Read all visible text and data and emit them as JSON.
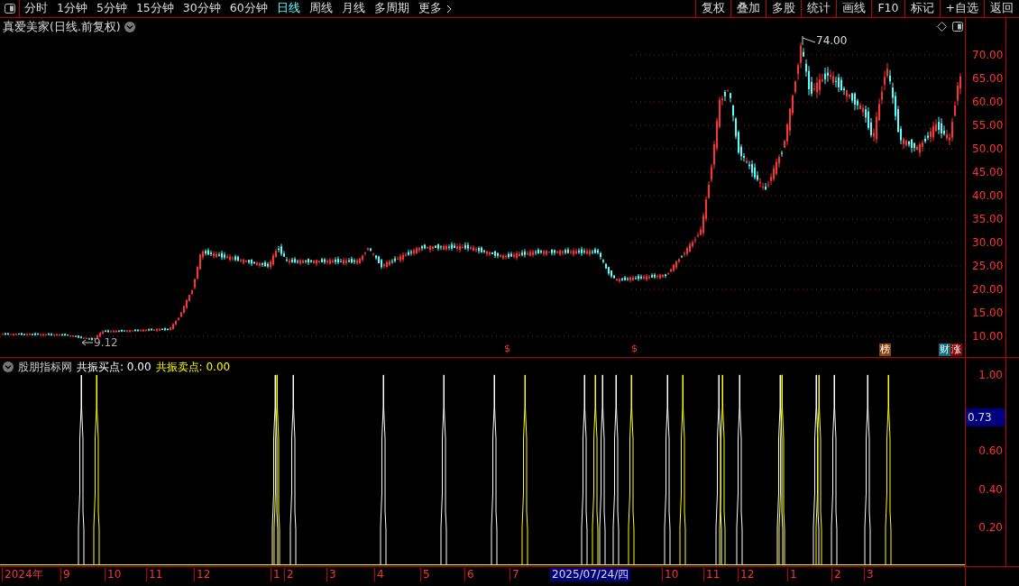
{
  "toolbar": {
    "periods": [
      {
        "label": "分时",
        "selected": false
      },
      {
        "label": "1分钟",
        "selected": false
      },
      {
        "label": "5分钟",
        "selected": false
      },
      {
        "label": "15分钟",
        "selected": false
      },
      {
        "label": "30分钟",
        "selected": false
      },
      {
        "label": "60分钟",
        "selected": false
      },
      {
        "label": "日线",
        "selected": true
      },
      {
        "label": "周线",
        "selected": false
      },
      {
        "label": "月线",
        "selected": false
      },
      {
        "label": "多周期",
        "selected": false
      },
      {
        "label": "更多",
        "selected": false
      }
    ],
    "buttons": [
      "复权",
      "叠加",
      "多股",
      "统计",
      "画线",
      "F10",
      "标记",
      "+自选",
      "返回"
    ]
  },
  "price_chart": {
    "title": "真爱美家(日线.前复权)",
    "high_label": "74.00",
    "low_label": "9.12",
    "event_markers": [
      "$",
      "$"
    ],
    "badges": [
      {
        "text": "榜",
        "color": "#8b4513"
      },
      {
        "text": "财",
        "color": "#0e6f7f"
      },
      {
        "text": "涨",
        "color": "#8b0000"
      }
    ],
    "axis_ticks": [
      "70.00",
      "65.00",
      "60.00",
      "55.00",
      "50.00",
      "45.00",
      "40.00",
      "35.00",
      "30.00",
      "25.00",
      "20.00",
      "15.00",
      "10.00"
    ]
  },
  "indicator": {
    "name": "股朋指标网",
    "legend": [
      {
        "text": "共振买点: 0.00",
        "color": "#ffffff"
      },
      {
        "text": "共振卖点: 0.00",
        "color": "#ffff00"
      }
    ],
    "axis_ticks": [
      "1.00",
      "0.60",
      "0.40",
      "0.20"
    ],
    "cursor_value": "0.73"
  },
  "date_axis": [
    {
      "text": "2024年",
      "highlighted": false
    },
    {
      "text": "9",
      "highlighted": false
    },
    {
      "text": "10",
      "highlighted": false
    },
    {
      "text": "11",
      "highlighted": false
    },
    {
      "text": "12",
      "highlighted": false
    },
    {
      "text": "1",
      "highlighted": false
    },
    {
      "text": "2",
      "highlighted": false
    },
    {
      "text": "3",
      "highlighted": false
    },
    {
      "text": "4",
      "highlighted": false
    },
    {
      "text": "5",
      "highlighted": false
    },
    {
      "text": "6",
      "highlighted": false
    },
    {
      "text": "7",
      "highlighted": false
    },
    {
      "text": "2025/07/24/四",
      "highlighted": true
    },
    {
      "text": "10",
      "highlighted": false
    },
    {
      "text": "11",
      "highlighted": false
    },
    {
      "text": "12",
      "highlighted": false
    },
    {
      "text": "1",
      "highlighted": false
    },
    {
      "text": "2",
      "highlighted": false
    },
    {
      "text": "3",
      "highlighted": false
    }
  ]
}
